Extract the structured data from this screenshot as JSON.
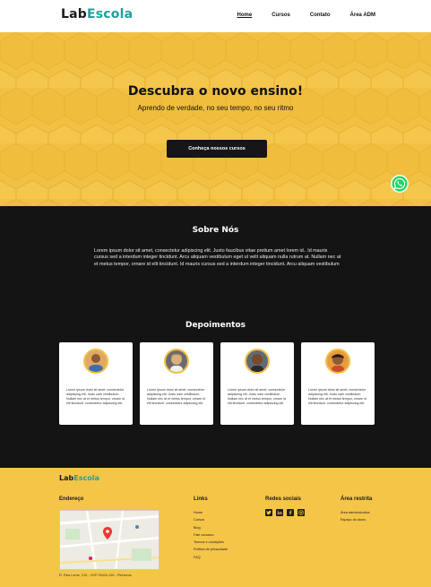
{
  "header": {
    "logo_part1": "Lab",
    "logo_part2": "Escola",
    "nav": [
      "Home",
      "Cursos",
      "Contato",
      "Área ADM"
    ]
  },
  "hero": {
    "title": "Descubra o novo ensino!",
    "subtitle": "Aprendo de verdade, no seu tempo, no seu ritmo",
    "button": "Conheça nossos cursos",
    "whatsapp_icon": "whatsapp-icon"
  },
  "about": {
    "title": "Sobre Nós",
    "text": "Lorem ipsum dolor sit amet, consectetur adipiscing elit. Justo faucibus vitae pretium amet lorem id.. Id mauris cursus sed a interdum integer tincidunt. Arcu aliquam vestibulum eget ut velit aliquam nulla rutrum at. Nullam nec at et metus tempor, ornare id elit tincidunt. Id mauris cursus sed a interdum integer tincidunt. Arcu aliquam vestibulum"
  },
  "testimonials": {
    "title": "Depoimentos",
    "items": [
      {
        "text": "Lorem ipsum dolor sit amet, consectetur adipiscing elit. Justo uam vestibulum. Nullam nec at et metus tempor, ornare id elit tincidunt. consectetur adipiscing elit."
      },
      {
        "text": "Lorem ipsum dolor sit amet, consectetur adipiscing elit. Justo uam vestibulum. Nullam nec at et metus tempor, ornare id elit tincidunt. consectetur adipiscing elit."
      },
      {
        "text": "Lorem ipsum dolor sit amet, consectetur adipiscing elit. Justo uam vestibulum. Nullam nec at et metus tempor, ornare id elit tincidunt. consectetur adipiscing elit."
      },
      {
        "text": "Lorem ipsum dolor sit amet, consectetur adipiscing elit. Justo uam vestibulum. Nullam nec at et metus tempor, ornare id elit tincidunt. consectetur adipiscing elit."
      }
    ]
  },
  "footer": {
    "logo_part1": "Lab",
    "logo_part2": "Escola",
    "address_title": "Endereço",
    "address": "R. Pais Leme, 215 - CEP 05424-150 - Pinheiros",
    "links_title": "Links",
    "links": [
      "Home",
      "Cursos",
      "Blog",
      "Fale conosco",
      "Termos e condições",
      "Política de privacidade",
      "FAQ"
    ],
    "social_title": "Redes sociais",
    "social_icons": [
      "twitter-icon",
      "linkedin-icon",
      "facebook-icon",
      "instagram-icon"
    ],
    "restricted_title": "Área restrita",
    "restricted_links": [
      "Área administrativa",
      "Espaço do aluno"
    ]
  },
  "colors": {
    "accent_yellow": "#f2c144",
    "dark": "#141414",
    "teal": "#1aa39a",
    "whatsapp": "#25d366"
  }
}
